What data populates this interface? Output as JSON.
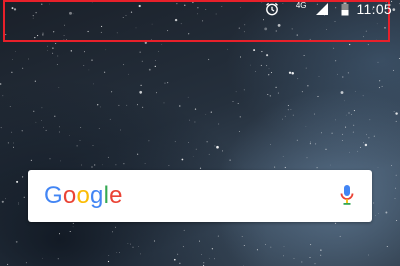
{
  "status_bar": {
    "network_label": "4G",
    "time": "11:05",
    "icons": [
      "alarm-icon",
      "network-4g-icon",
      "signal-icon",
      "battery-icon"
    ]
  },
  "search": {
    "logo_letters": [
      "G",
      "o",
      "o",
      "g",
      "l",
      "e"
    ],
    "logo_colors": [
      "#4285F4",
      "#EA4335",
      "#FBBC05",
      "#4285F4",
      "#34A853",
      "#EA4335"
    ],
    "mic_icon": "mic-icon"
  },
  "colors": {
    "highlight_border": "#e8202a",
    "search_background": "#ffffff"
  }
}
